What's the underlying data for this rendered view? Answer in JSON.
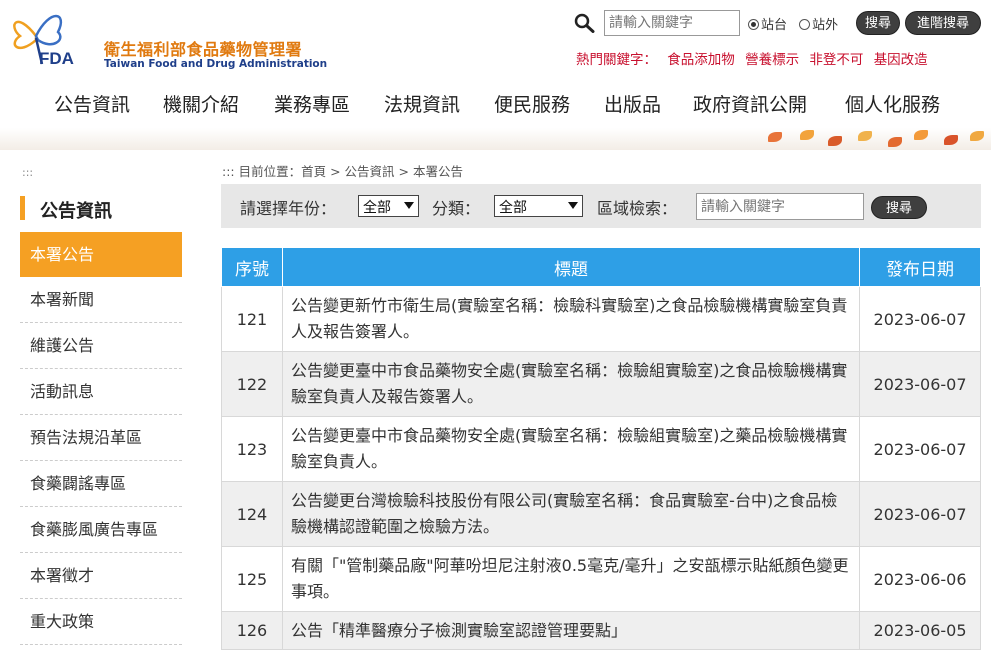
{
  "header": {
    "logo_fda": "FDA",
    "logo_cn": "衛生福利部食品藥物管理署",
    "logo_en": "Taiwan Food and Drug Administration",
    "search": {
      "placeholder": "請輸入關鍵字",
      "radio_site": "站台",
      "radio_external": "站外",
      "search_label": "搜尋",
      "advanced_label": "進階搜尋"
    },
    "hot_keys": {
      "label": "熱門關鍵字：",
      "items": [
        "食品添加物",
        "營養標示",
        "非登不可",
        "基因改造"
      ]
    },
    "nav": [
      "公告資訊",
      "機關介紹",
      "業務專區",
      "法規資訊",
      "便民服務",
      "出版品",
      "政府資訊公開",
      "個人化服務"
    ]
  },
  "sidebar": {
    "dots": ":::",
    "title": "公告資訊",
    "items": [
      {
        "label": "本署公告",
        "active": true
      },
      {
        "label": "本署新聞"
      },
      {
        "label": "維護公告"
      },
      {
        "label": "活動訊息"
      },
      {
        "label": "預告法規沿革區"
      },
      {
        "label": "食藥闢謠專區"
      },
      {
        "label": "食藥膨風廣告專區"
      },
      {
        "label": "本署徵才"
      },
      {
        "label": "重大政策"
      }
    ]
  },
  "breadcrumb": "::: 目前位置：首頁 > 公告資訊 > 本署公告",
  "filter": {
    "year_label": "請選擇年份：",
    "year_value": "全部",
    "category_label": "分類：",
    "category_value": "全部",
    "region_label": "區域檢索：",
    "region_placeholder": "請輸入關鍵字",
    "search_label": "搜尋"
  },
  "table": {
    "headers": [
      "序號",
      "標題",
      "發布日期"
    ],
    "rows": [
      {
        "num": "121",
        "title": "公告變更新竹市衛生局(實驗室名稱：檢驗科實驗室)之食品檢驗機構實驗室負責人及報告簽署人。",
        "date": "2023-06-07"
      },
      {
        "num": "122",
        "title": "公告變更臺中市食品藥物安全處(實驗室名稱：檢驗組實驗室)之食品檢驗機構實驗室負責人及報告簽署人。",
        "date": "2023-06-07"
      },
      {
        "num": "123",
        "title": "公告變更臺中市食品藥物安全處(實驗室名稱：檢驗組實驗室)之藥品檢驗機構實驗室負責人。",
        "date": "2023-06-07"
      },
      {
        "num": "124",
        "title": "公告變更台灣檢驗科技股份有限公司(實驗室名稱：食品實驗室-台中)之食品檢驗機構認證範圍之檢驗方法。",
        "date": "2023-06-07"
      },
      {
        "num": "125",
        "title": "有關「\"管制藥品廠\"阿華吩坦尼注射液0.5毫克/毫升」之安瓿標示貼紙顏色變更事項。",
        "date": "2023-06-06"
      },
      {
        "num": "126",
        "title": "公告「精準醫療分子檢測實驗室認證管理要點」",
        "date": "2023-06-05"
      }
    ]
  }
}
